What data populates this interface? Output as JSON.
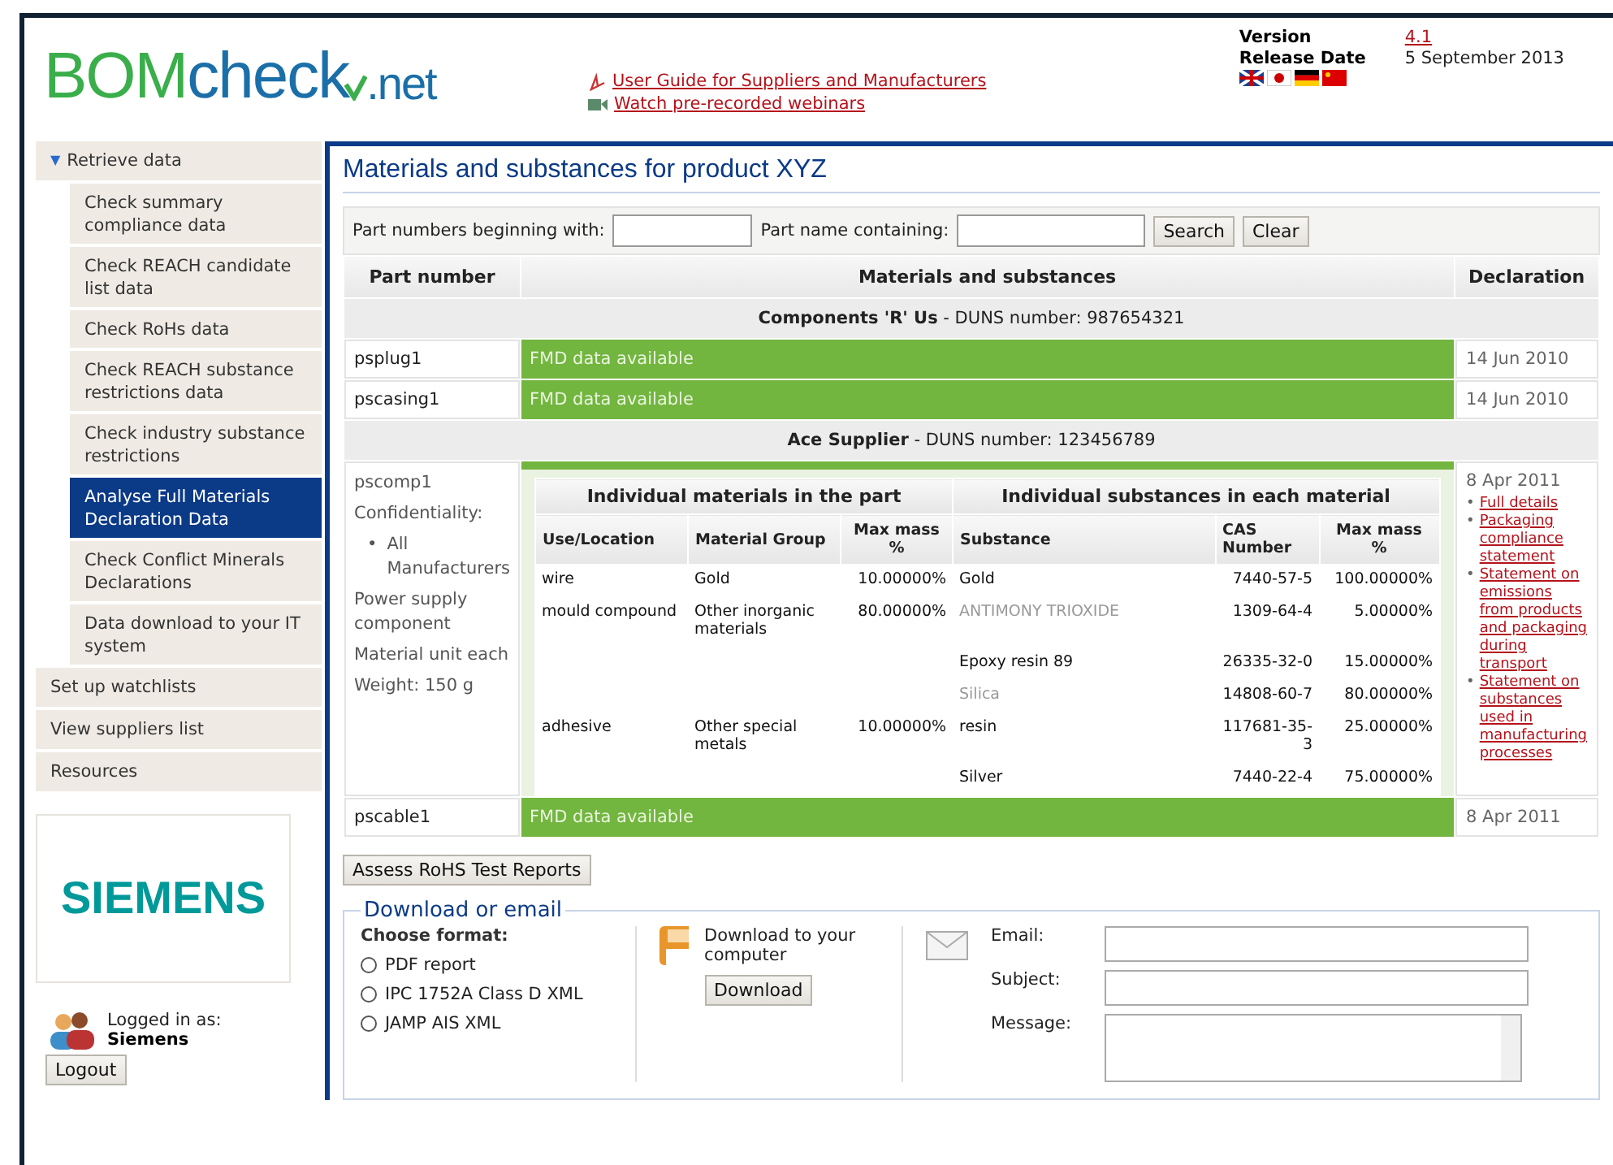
{
  "header": {
    "logo": {
      "part_a": "BOM",
      "part_b": "check",
      "part_c": ".net"
    },
    "links": [
      {
        "kind": "pdf",
        "label": "User Guide for Suppliers and Manufacturers"
      },
      {
        "kind": "video",
        "label": "Watch pre-recorded webinars"
      }
    ],
    "version": {
      "label": "Version",
      "value": "4.1",
      "date_label": "Release Date",
      "date": "5 September 2013"
    }
  },
  "sidebar": {
    "items": [
      {
        "label": "Retrieve data",
        "expander": "▼",
        "expanded": true,
        "selected": false,
        "children": [
          {
            "label": "Check summary compliance data",
            "selected": false
          },
          {
            "label": "Check REACH candidate list data",
            "selected": false
          },
          {
            "label": "Check RoHs data",
            "selected": false
          },
          {
            "label": "Check REACH substance restrictions data",
            "selected": false
          },
          {
            "label": "Check industry substance restrictions",
            "selected": false
          },
          {
            "label": "Analyse Full Materials Declaration Data",
            "selected": true
          },
          {
            "label": "Check Conflict Minerals Declarations",
            "selected": false
          },
          {
            "label": "Data download to your IT system",
            "selected": false
          }
        ]
      },
      {
        "label": "Set up watchlists",
        "expanded": false,
        "selected": false
      },
      {
        "label": "View suppliers list",
        "expanded": false,
        "selected": false
      },
      {
        "label": "Resources",
        "expanded": false,
        "selected": false
      }
    ],
    "company_logo": "SIEMENS",
    "logged_in_label": "Logged in as:",
    "user": "Siemens",
    "logout": "Logout"
  },
  "main": {
    "title": "Materials and substances for product XYZ",
    "filters": {
      "part_number_label": "Part numbers beginning with:",
      "part_name_label": "Part name containing:",
      "search": "Search",
      "clear": "Clear"
    },
    "table": {
      "columns": [
        "Part number",
        "Materials and substances",
        "Declaration"
      ],
      "groups": [
        {
          "supplier": "Components 'R' Us",
          "duns": " - DUNS number: 987654321",
          "rows": [
            {
              "part": "psplug1",
              "status": "FMD data available",
              "date": "14 Jun 2010",
              "expanded": false
            },
            {
              "part": "pscasing1",
              "status": "FMD data available",
              "date": "14 Jun 2010",
              "expanded": false
            }
          ]
        },
        {
          "supplier": "Ace Supplier",
          "duns": " - DUNS number: 123456789",
          "rows": [
            {
              "part": "pscomp1",
              "date": "8 Apr 2011",
              "expanded": true,
              "bullet": "•",
              "info": {
                "confidentiality_label": "Confidentiality:",
                "confidentiality": [
                  "All Manufacturers"
                ],
                "description": "Power supply component",
                "unit": "Material unit each",
                "weight": "Weight: 150 g"
              },
              "detail": {
                "headings": [
                  "Individual materials in the part",
                  "Individual substances in each material"
                ],
                "columns": [
                  "Use/Location",
                  "Material Group",
                  "Max mass %",
                  "Substance",
                  "CAS Number",
                  "Max mass %"
                ],
                "materials": [
                  {
                    "use": "wire",
                    "group": "Gold",
                    "mass": "10.00000%",
                    "substances": [
                      {
                        "name": "Gold",
                        "cas": "7440-57-5",
                        "mass": "100.00000%",
                        "greyed": false
                      }
                    ]
                  },
                  {
                    "use": "mould compound",
                    "group": "Other inorganic materials",
                    "mass": "80.00000%",
                    "substances": [
                      {
                        "name": "ANTIMONY TRIOXIDE",
                        "cas": "1309-64-4",
                        "mass": "5.00000%",
                        "greyed": true
                      },
                      {
                        "name": "Epoxy resin 89",
                        "cas": "26335-32-0",
                        "mass": "15.00000%",
                        "greyed": false
                      },
                      {
                        "name": "Silica",
                        "cas": "14808-60-7",
                        "mass": "80.00000%",
                        "greyed": true
                      }
                    ]
                  },
                  {
                    "use": "adhesive",
                    "group": "Other special metals",
                    "mass": "10.00000%",
                    "substances": [
                      {
                        "name": "resin",
                        "cas": "117681-35-3",
                        "mass": "25.00000%",
                        "greyed": false
                      },
                      {
                        "name": "Silver",
                        "cas": "7440-22-4",
                        "mass": "75.00000%",
                        "greyed": false
                      }
                    ]
                  }
                ]
              },
              "links": [
                "Full details",
                "Packaging compliance statement",
                "Statement on emissions from products and packaging during transport",
                "Statement on substances used in manufacturing processes"
              ]
            },
            {
              "part": "pscable1",
              "status": "FMD data available",
              "date": "8 Apr 2011",
              "expanded": false
            }
          ]
        }
      ]
    },
    "assess": "Assess RoHS Test Reports",
    "export": {
      "legend": "Download or email",
      "format_heading": "Choose format:",
      "formats": [
        {
          "label": "PDF report",
          "selected": false
        },
        {
          "label": "IPC 1752A Class D XML",
          "selected": false
        },
        {
          "label": "JAMP AIS XML",
          "selected": false
        }
      ],
      "download_text": "Download to your computer",
      "download": "Download",
      "email_label": "Email:",
      "subject_label": "Subject:",
      "message_label": "Message:"
    }
  }
}
